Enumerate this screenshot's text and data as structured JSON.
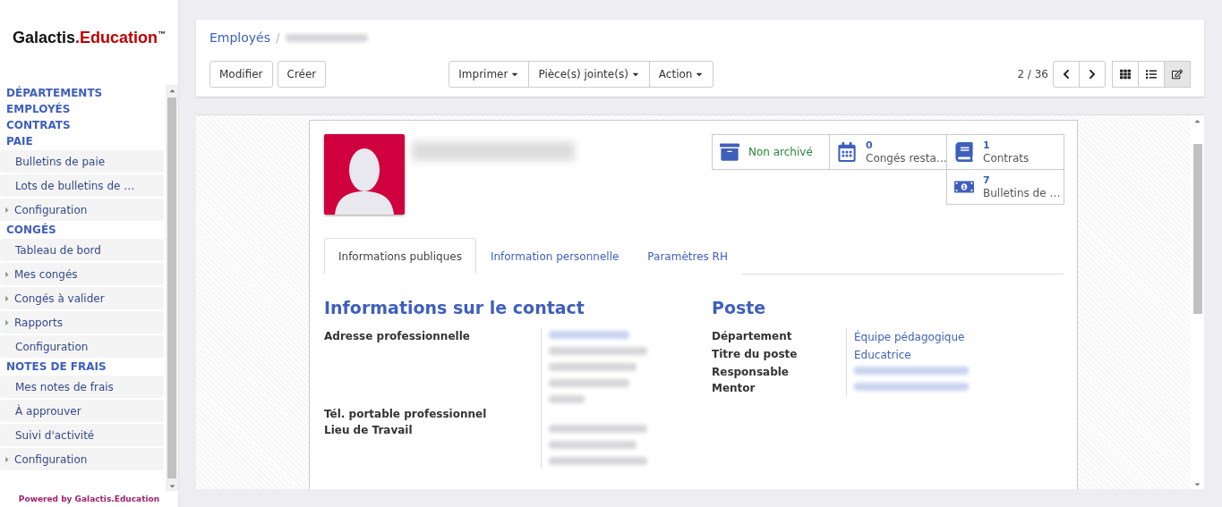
{
  "logo": {
    "brand": "Galactis",
    "suffix": ".Education",
    "mark": "™"
  },
  "sidebar": {
    "sections": [
      {
        "kind": "heading",
        "label": "DÉPARTEMENTS"
      },
      {
        "kind": "heading",
        "label": "EMPLOYÉS"
      },
      {
        "kind": "heading",
        "label": "CONTRATS"
      },
      {
        "kind": "heading",
        "label": "PAIE"
      },
      {
        "kind": "item",
        "label": "Bulletins de paie",
        "expandable": false
      },
      {
        "kind": "item",
        "label": "Lots de bulletins de …",
        "expandable": false
      },
      {
        "kind": "item",
        "label": "Configuration",
        "expandable": true
      },
      {
        "kind": "heading",
        "label": "CONGÉS"
      },
      {
        "kind": "item",
        "label": "Tableau de bord",
        "expandable": false
      },
      {
        "kind": "item",
        "label": "Mes congés",
        "expandable": true
      },
      {
        "kind": "item",
        "label": "Congés à valider",
        "expandable": true
      },
      {
        "kind": "item",
        "label": "Rapports",
        "expandable": true
      },
      {
        "kind": "item",
        "label": "Configuration",
        "expandable": false
      },
      {
        "kind": "heading",
        "label": "NOTES DE FRAIS"
      },
      {
        "kind": "item",
        "label": "Mes notes de frais",
        "expandable": false
      },
      {
        "kind": "item",
        "label": "À approuver",
        "expandable": false
      },
      {
        "kind": "item",
        "label": "Suivi d'activité",
        "expandable": false
      },
      {
        "kind": "item",
        "label": "Configuration",
        "expandable": true
      }
    ],
    "footer": "Powered by Galactis.Education"
  },
  "breadcrumb": {
    "parent": "Employés",
    "separator": "/"
  },
  "buttons": {
    "left": [
      "Modifier",
      "Créer"
    ],
    "dropdowns": [
      "Imprimer",
      "Pièce(s) jointe(s)",
      "Action"
    ]
  },
  "pager": {
    "value": "2 / 36"
  },
  "views": [
    {
      "kind": "kanban",
      "selected": false
    },
    {
      "kind": "list",
      "selected": false
    },
    {
      "kind": "form",
      "selected": true
    }
  ],
  "stat_buttons": [
    {
      "kind": "archive",
      "label": "Non archivé"
    },
    {
      "kind": "calendar",
      "value": "0",
      "label": "Congés resta…"
    },
    {
      "kind": "book",
      "value": "1",
      "label": "Contrats"
    },
    {
      "kind": "money",
      "value": "7",
      "label": "Bulletins de …"
    }
  ],
  "tabs": [
    {
      "label": "Informations publiques",
      "selected": true
    },
    {
      "label": "Information personnelle",
      "selected": false
    },
    {
      "label": "Paramètres RH",
      "selected": false
    }
  ],
  "contact": {
    "title": "Informations sur le contact",
    "fields": [
      {
        "label": "Adresse professionnelle",
        "kind": "address"
      },
      {
        "label": "Tél. portable professionnel",
        "kind": "empty"
      },
      {
        "label": "Lieu de Travail",
        "kind": "lines"
      }
    ]
  },
  "poste": {
    "title": "Poste",
    "fields": [
      {
        "label": "Département",
        "kind": "text",
        "value": "Équipe pédagogique"
      },
      {
        "label": "Titre du poste",
        "kind": "text",
        "value": "Educatrice"
      },
      {
        "label": "Responsable",
        "kind": "link"
      },
      {
        "label": "Mentor",
        "kind": "link"
      }
    ]
  }
}
